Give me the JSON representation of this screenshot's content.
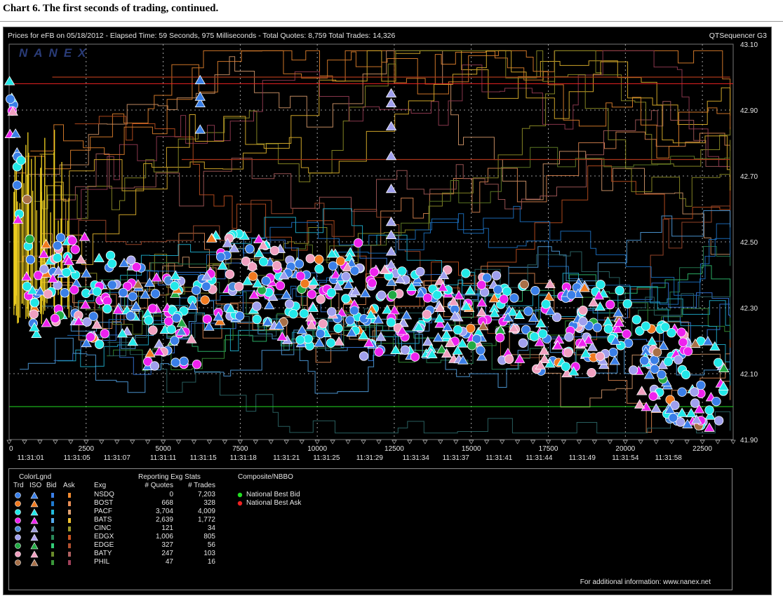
{
  "heading": "Chart 6. The first seconds of trading, continued.",
  "chart_header": {
    "title_left": "Prices for  eFB  on  05/18/2012  -  Elapsed Time: 59 Seconds, 975 Milliseconds  -  Total Quotes: 8,759  Total Trades: 14,326",
    "title_right": "QTSequencer G3",
    "watermark": "NANEX"
  },
  "colors": {
    "background": "#000000",
    "grid": "#c8c8c8",
    "nbbo_bid": "#22dd22",
    "nbbo_ask": "#ee2222"
  },
  "chart_data": {
    "type": "scatter",
    "y_ticks": [
      "43.10",
      "42.90",
      "42.70",
      "42.50",
      "42.30",
      "42.10",
      "41.90"
    ],
    "ylim": [
      41.9,
      43.1
    ],
    "x_ticks": [
      "0",
      "2500",
      "5000",
      "7500",
      "10000",
      "12500",
      "15000",
      "17500",
      "20000",
      "22500"
    ],
    "xlim": [
      0,
      23500
    ],
    "time_ticks": [
      {
        "x": 700,
        "label": "11:31:01"
      },
      {
        "x": 2200,
        "label": "11:31:05"
      },
      {
        "x": 3500,
        "label": "11:31:07"
      },
      {
        "x": 5000,
        "label": "11:31:11"
      },
      {
        "x": 6300,
        "label": "11:31:15"
      },
      {
        "x": 7600,
        "label": "11:31:18"
      },
      {
        "x": 9000,
        "label": "11:31:21"
      },
      {
        "x": 10300,
        "label": "11:31:25"
      },
      {
        "x": 11700,
        "label": "11:31:29"
      },
      {
        "x": 13200,
        "label": "11:31:34"
      },
      {
        "x": 14500,
        "label": "11:31:37"
      },
      {
        "x": 15900,
        "label": "11:31:41"
      },
      {
        "x": 17200,
        "label": "11:31:44"
      },
      {
        "x": 18600,
        "label": "11:31:49"
      },
      {
        "x": 20000,
        "label": "11:31:54"
      },
      {
        "x": 21400,
        "label": "11:31:58"
      }
    ],
    "nbbo_ask_level": 42.98,
    "nbbo_bid_level": 42.0
  },
  "legend": {
    "color_legend_title": "ColorLgnd",
    "col_trd": "Trd",
    "col_iso": "ISO",
    "col_bid": "Bid",
    "col_ask": "Ask",
    "col_exg": "Exg",
    "stats_title": "Reporting Exg Stats",
    "col_quotes": "# Quotes",
    "col_trades": "# Trades",
    "composite_title": "Composite/NBBO",
    "nbbo_bid_label": "National Best Bid",
    "nbbo_ask_label": "National Best Ask",
    "footer": "For additional information: www.nanex.net",
    "exchanges": [
      {
        "name": "NSDQ",
        "quotes": "0",
        "trades": "7,203",
        "trd": "#3a7fe8",
        "iso": "#3a7fe8",
        "bid": "#3a7fe8",
        "ask": "#f08a30"
      },
      {
        "name": "BOST",
        "quotes": "668",
        "trades": "328",
        "trd": "#f07a20",
        "iso": "#f07a20",
        "bid": "#1f7ad0",
        "ask": "#e88d55"
      },
      {
        "name": "PACF",
        "quotes": "3,704",
        "trades": "4,009",
        "trd": "#22e8e8",
        "iso": "#22e8e8",
        "bid": "#22bbdd",
        "ask": "#e0a070"
      },
      {
        "name": "BATS",
        "quotes": "2,639",
        "trades": "1,772",
        "trd": "#ee22ee",
        "iso": "#ee22ee",
        "bid": "#55aaee",
        "ask": "#f0c030"
      },
      {
        "name": "CINC",
        "quotes": "121",
        "trades": "34",
        "trd": "#4a8ad8",
        "iso": "#9a9ad8",
        "bid": "#2f6f6f",
        "ask": "#9a9a2a"
      },
      {
        "name": "EDGX",
        "quotes": "1,006",
        "trades": "805",
        "trd": "#a0a0ee",
        "iso": "#b0a0ee",
        "bid": "#2a8a5a",
        "ask": "#cc5522"
      },
      {
        "name": "EDGE",
        "quotes": "327",
        "trades": "56",
        "trd": "#22aa44",
        "iso": "#22aa44",
        "bid": "#33cc77",
        "ask": "#b05030"
      },
      {
        "name": "BATY",
        "quotes": "247",
        "trades": "103",
        "trd": "#f0a0c0",
        "iso": "#f0a0c0",
        "bid": "#6a8a2a",
        "ask": "#b06060"
      },
      {
        "name": "PHIL",
        "quotes": "47",
        "trades": "16",
        "trd": "#a87048",
        "iso": "#a87048",
        "bid": "#3a9a3a",
        "ask": "#a0405a"
      }
    ]
  }
}
